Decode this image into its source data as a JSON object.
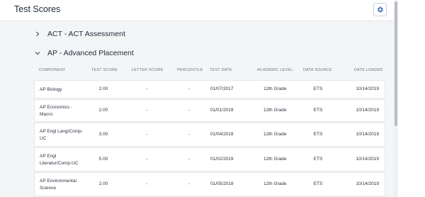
{
  "header": {
    "title": "Test Scores"
  },
  "sections": [
    {
      "label": "ACT - ACT Assessment",
      "expanded": false
    },
    {
      "label": "AP - Advanced Placement",
      "expanded": true
    }
  ],
  "table": {
    "columns": [
      "COMPONENT",
      "TEST SCORE",
      "LETTER SCORE",
      "PERCENTILE",
      "TEST DATE",
      "ACADEMIC LEVEL",
      "DATA SOURCE",
      "DATE LOADED"
    ],
    "rows": [
      {
        "component": "AP Biology",
        "test_score": "2.00",
        "letter_score": "-",
        "percentile": "-",
        "test_date": "01/07/2017",
        "academic_level": "12th Grade",
        "data_source": "ETS",
        "date_loaded": "10/14/2019"
      },
      {
        "component": "AP Economics - Macro",
        "test_score": "2.00",
        "letter_score": "-",
        "percentile": "-",
        "test_date": "01/01/2019",
        "academic_level": "12th Grade",
        "data_source": "ETS",
        "date_loaded": "10/14/2019"
      },
      {
        "component": "AP Engl Lang/Comp-UC",
        "test_score": "3.00",
        "letter_score": "-",
        "percentile": "-",
        "test_date": "01/04/2018",
        "academic_level": "12th Grade",
        "data_source": "ETS",
        "date_loaded": "10/14/2019"
      },
      {
        "component": "AP Engl Literatur/Comp-UC",
        "test_score": "5.00",
        "letter_score": "-",
        "percentile": "-",
        "test_date": "01/02/2019",
        "academic_level": "12th Grade",
        "data_source": "ETS",
        "date_loaded": "10/14/2019"
      },
      {
        "component": "AP Environmental Science",
        "test_score": "2.00",
        "letter_score": "-",
        "percentile": "-",
        "test_date": "01/05/2018",
        "academic_level": "12th Grade",
        "data_source": "ETS",
        "date_loaded": "10/14/2019"
      }
    ]
  },
  "icons": {
    "settings": "gear-icon",
    "collapsed": "chevron-right-icon",
    "expanded": "chevron-down-icon"
  },
  "colors": {
    "page_bg": "#f4f5f7",
    "card_bg": "#ffffff",
    "text": "#1f2a37",
    "muted": "#6b7480"
  }
}
